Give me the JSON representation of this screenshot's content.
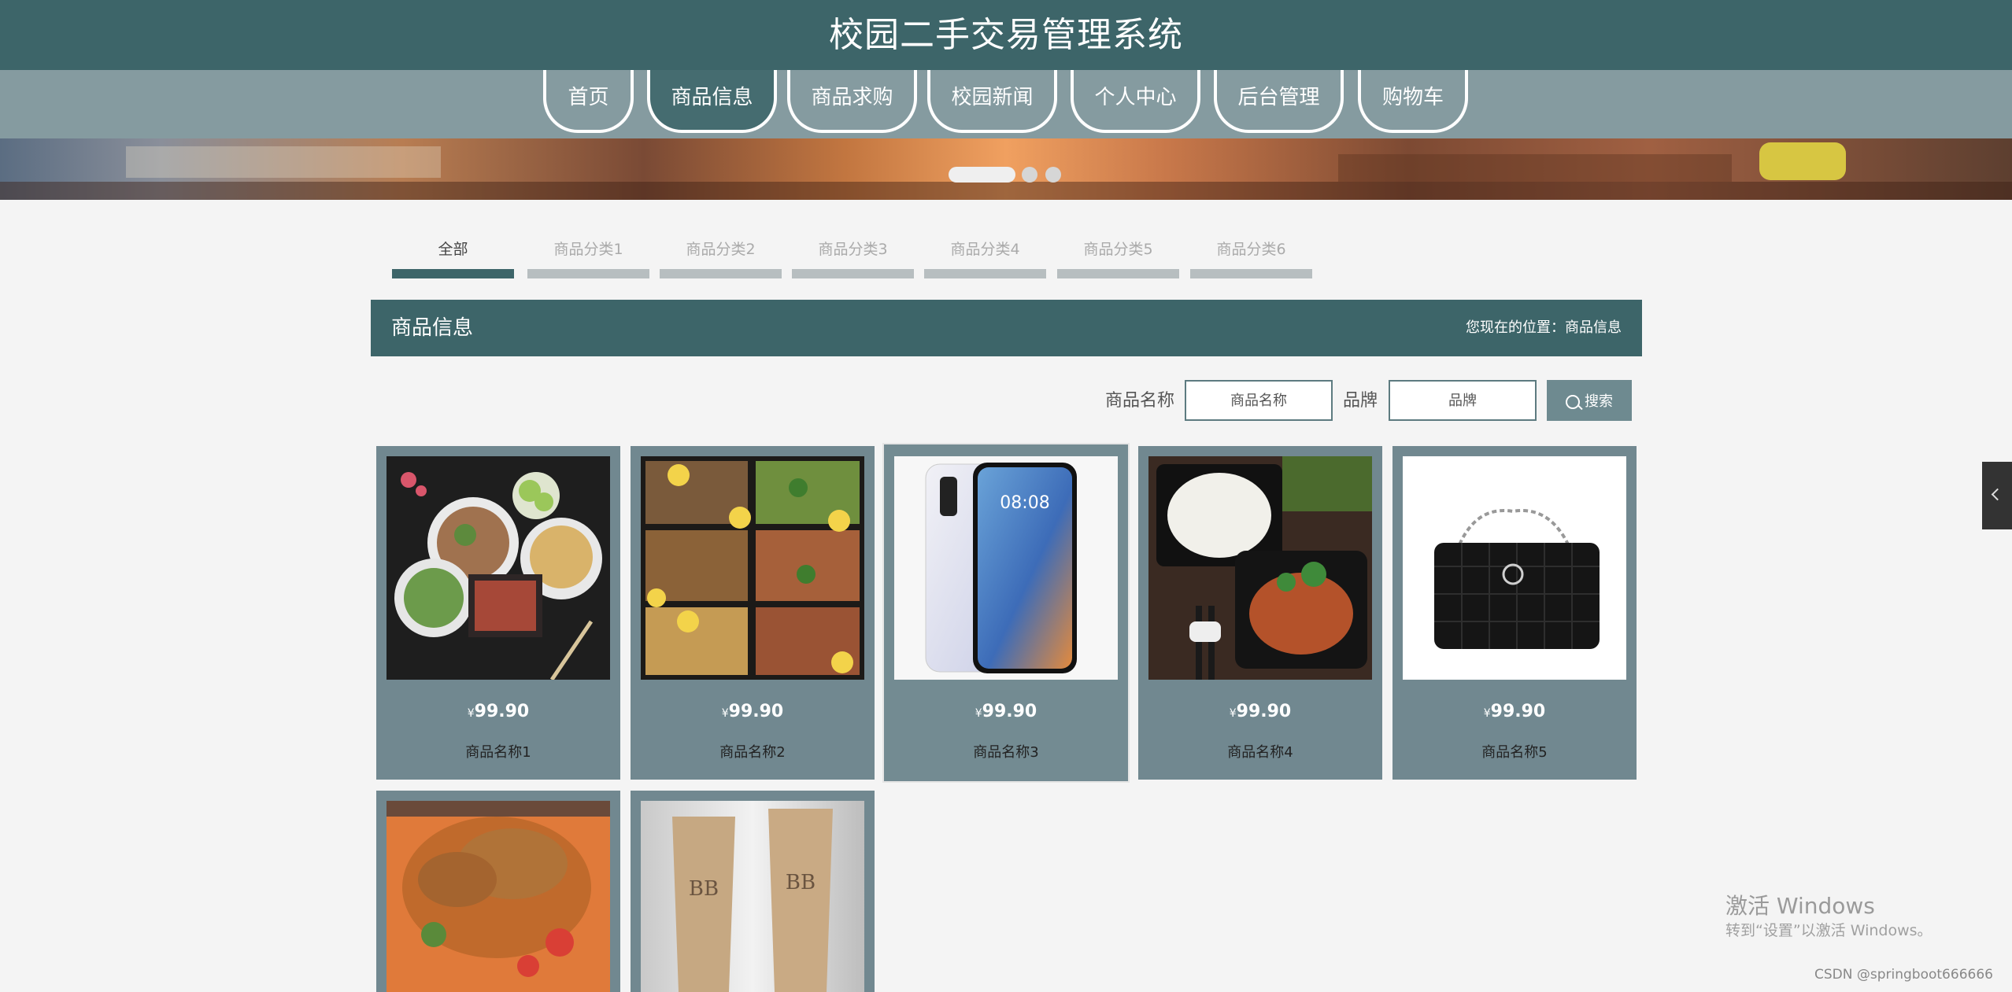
{
  "header": {
    "title": "校园二手交易管理系统"
  },
  "nav": [
    {
      "label": "首页",
      "active": false
    },
    {
      "label": "商品信息",
      "active": true
    },
    {
      "label": "商品求购",
      "active": false
    },
    {
      "label": "校园新闻",
      "active": false
    },
    {
      "label": "个人中心",
      "active": false
    },
    {
      "label": "后台管理",
      "active": false
    },
    {
      "label": "购物车",
      "active": false
    }
  ],
  "carousel": {
    "slides": 3,
    "active": 1
  },
  "categories": [
    "全部",
    "商品分类1",
    "商品分类2",
    "商品分类3",
    "商品分类4",
    "商品分类5",
    "商品分类6"
  ],
  "section": {
    "title": "商品信息",
    "breadcrumb": "您现在的位置：商品信息"
  },
  "search": {
    "name_label": "商品名称",
    "name_placeholder": "商品名称",
    "brand_label": "品牌",
    "brand_placeholder": "品牌",
    "button": "搜索"
  },
  "products": [
    {
      "name": "商品名称1",
      "currency": "¥",
      "price": "99.90",
      "image": "food-bento-icon"
    },
    {
      "name": "商品名称2",
      "currency": "¥",
      "price": "99.90",
      "image": "food-boxes-icon"
    },
    {
      "name": "商品名称3",
      "currency": "¥",
      "price": "99.90",
      "image": "smartphone-icon"
    },
    {
      "name": "商品名称4",
      "currency": "¥",
      "price": "99.90",
      "image": "rice-chicken-icon"
    },
    {
      "name": "商品名称5",
      "currency": "¥",
      "price": "99.90",
      "image": "handbag-icon"
    },
    {
      "name": "",
      "currency": "",
      "price": "",
      "image": "fried-chicken-icon"
    },
    {
      "name": "",
      "currency": "",
      "price": "",
      "image": "bb-cream-icon"
    }
  ],
  "watermark": {
    "line1": "激活 Windows",
    "line2": "转到“设置”以激活 Windows。",
    "csdn": "CSDN @springboot666666"
  },
  "colors": {
    "primary": "#3d6569",
    "nav": "#859ba0",
    "card": "#718890"
  }
}
